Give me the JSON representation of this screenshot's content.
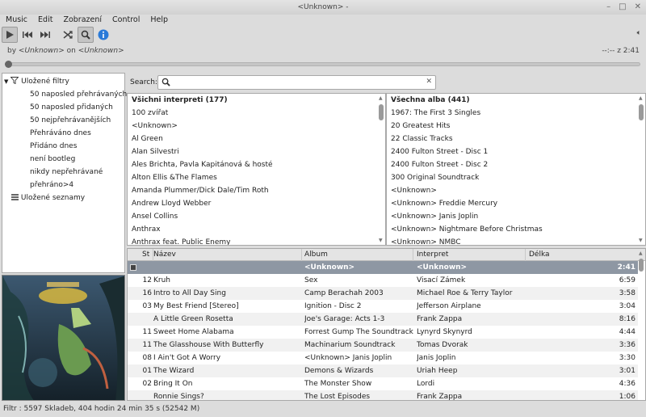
{
  "window": {
    "title": "<Unknown> -"
  },
  "menu": [
    "Music",
    "Edit",
    "Zobrazení",
    "Control",
    "Help"
  ],
  "toolbar": [
    "play-icon",
    "previous-icon",
    "next-icon",
    "shuffle-icon",
    "search-icon",
    "info-icon"
  ],
  "now_playing": {
    "by": "by",
    "artist": "<Unknown>",
    "on": "on",
    "album": "<Unknown>",
    "time": "--:-- z 2:41",
    "progress": 0.0
  },
  "library": {
    "root": "Uložené filtry",
    "filters": [
      "50 naposled přehrávaných",
      "50 naposled přidaných",
      "50 nejpřehrávanějších",
      "Přehráváno dnes",
      "Přidáno dnes",
      "není bootleg",
      "nikdy nepřehrávané",
      "přehráno>4"
    ],
    "playlists": "Uložené seznamy"
  },
  "search": {
    "label": "Search:",
    "value": ""
  },
  "artists": {
    "header": "Všichni interpreti (177)",
    "items": [
      "100 zvířat",
      "<Unknown>",
      "Al Green",
      "Alan Silvestri",
      "Ales Brichta, Pavla Kapitánová & hosté",
      "Alton Ellis &The Flames",
      "Amanda Plummer/Dick Dale/Tim Roth",
      "Andrew Lloyd Webber",
      "Ansel Collins",
      "Anthrax",
      "Anthrax feat. Public Enemy"
    ]
  },
  "albums": {
    "header": "Všechna alba (441)",
    "items": [
      "1967: The First 3 Singles",
      "20 Greatest Hits",
      "22 Classic Tracks",
      "2400 Fulton Street - Disc 1",
      "2400 Fulton Street - Disc 2",
      "300 Original Soundtrack",
      "<Unknown>",
      "<Unknown> Freddie Mercury",
      "<Unknown> Janis Joplin",
      "<Unknown> Nightmare Before Christmas",
      "<Unknown> NMBC"
    ]
  },
  "columns": {
    "st": "St",
    "title": "Název",
    "album": "Album",
    "artist": "Interpret",
    "length": "Délka"
  },
  "tracks": [
    {
      "st": "",
      "title": "",
      "album": "<Unknown>",
      "artist": "<Unknown>",
      "length": "2:41"
    },
    {
      "st": "12",
      "title": "Kruh",
      "album": "Sex",
      "artist": "Visací Zámek",
      "length": "6:59"
    },
    {
      "st": "16",
      "title": "Intro to All Day Sing",
      "album": "Camp Berachah 2003",
      "artist": "Michael Roe & Terry Taylor",
      "length": "3:58"
    },
    {
      "st": "03",
      "title": "My Best Friend [Stereo]",
      "album": "Ignition - Disc 2",
      "artist": "Jefferson Airplane",
      "length": "3:04"
    },
    {
      "st": "",
      "title": "A Little Green Rosetta",
      "album": "Joe's Garage: Acts 1-3",
      "artist": "Frank Zappa",
      "length": "8:16"
    },
    {
      "st": "11",
      "title": "Sweet Home Alabama",
      "album": "Forrest Gump The Soundtrack",
      "artist": "Lynyrd Skynyrd",
      "length": "4:44"
    },
    {
      "st": "11",
      "title": "The Glasshouse With Butterfly",
      "album": "Machinarium Soundtrack",
      "artist": "Tomas Dvorak",
      "length": "3:36"
    },
    {
      "st": "08",
      "title": "I Ain't Got A Worry",
      "album": "<Unknown> Janis Joplin",
      "artist": "Janis Joplin",
      "length": "3:30"
    },
    {
      "st": "01",
      "title": "The Wizard",
      "album": "Demons & Wizards",
      "artist": "Uriah Heep",
      "length": "3:01"
    },
    {
      "st": "02",
      "title": "Bring It On",
      "album": "The Monster Show",
      "artist": "Lordi",
      "length": "4:36"
    },
    {
      "st": "",
      "title": "Ronnie Sings?",
      "album": "The Lost Episodes",
      "artist": "Frank Zappa",
      "length": "1:06"
    }
  ],
  "status": "Filtr : 5597 Skladeb, 404 hodin 24 min 35 s (52542 M)",
  "colors": {
    "selected_row": "#8e97a3",
    "info_icon": "#2a7ad8"
  }
}
